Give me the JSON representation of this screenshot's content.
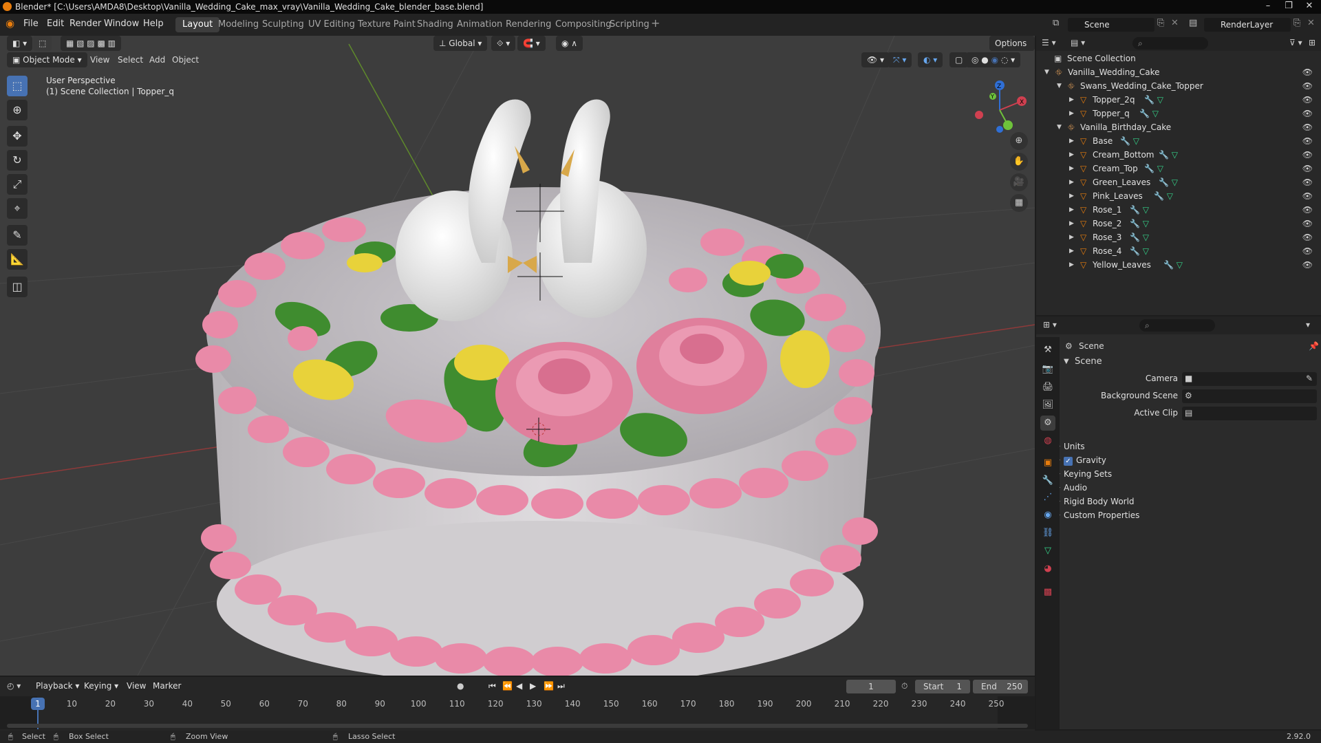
{
  "title": "Blender* [C:\\Users\\AMDA8\\Desktop\\Vanilla_Wedding_Cake_max_vray\\Vanilla_Wedding_Cake_blender_base.blend]",
  "menu": [
    "File",
    "Edit",
    "Render",
    "Window",
    "Help"
  ],
  "workspaces": [
    "Layout",
    "Modeling",
    "Sculpting",
    "UV Editing",
    "Texture Paint",
    "Shading",
    "Animation",
    "Rendering",
    "Compositing",
    "Scripting"
  ],
  "active_workspace": "Layout",
  "scene_name": "Scene",
  "view_layer": "RenderLayer",
  "viewport": {
    "transform_orientation": "Global",
    "options_label": "Options",
    "mode": "Object Mode",
    "header_menus": [
      "View",
      "Select",
      "Add",
      "Object"
    ],
    "info_line1": "User Perspective",
    "info_line2": "(1) Scene Collection | Topper_q"
  },
  "outliner": {
    "root": "Scene Collection",
    "rows": [
      {
        "label": "Vanilla_Wedding_Cake",
        "level": 1,
        "type": "collection"
      },
      {
        "label": "Swans_Wedding_Cake_Topper",
        "level": 2,
        "type": "collection"
      },
      {
        "label": "Topper_2q",
        "level": 3,
        "type": "mesh"
      },
      {
        "label": "Topper_q",
        "level": 3,
        "type": "mesh"
      },
      {
        "label": "Vanilla_Birthday_Cake",
        "level": 2,
        "type": "collection"
      },
      {
        "label": "Base",
        "level": 3,
        "type": "mesh"
      },
      {
        "label": "Cream_Bottom",
        "level": 3,
        "type": "mesh"
      },
      {
        "label": "Cream_Top",
        "level": 3,
        "type": "mesh"
      },
      {
        "label": "Green_Leaves",
        "level": 3,
        "type": "mesh"
      },
      {
        "label": "Pink_Leaves",
        "level": 3,
        "type": "mesh"
      },
      {
        "label": "Rose_1",
        "level": 3,
        "type": "mesh"
      },
      {
        "label": "Rose_2",
        "level": 3,
        "type": "mesh"
      },
      {
        "label": "Rose_3",
        "level": 3,
        "type": "mesh"
      },
      {
        "label": "Rose_4",
        "level": 3,
        "type": "mesh"
      },
      {
        "label": "Yellow_Leaves",
        "level": 3,
        "type": "mesh"
      }
    ]
  },
  "properties": {
    "context": "Scene",
    "panel_title": "Scene",
    "camera_label": "Camera",
    "background_scene_label": "Background Scene",
    "active_clip_label": "Active Clip",
    "sections": [
      "Units",
      "Gravity",
      "Keying Sets",
      "Audio",
      "Rigid Body World",
      "Custom Properties"
    ],
    "gravity_checked": true
  },
  "timeline": {
    "menus": [
      "Playback",
      "Keying",
      "View",
      "Marker"
    ],
    "current_frame": "1",
    "start_label": "Start",
    "start": "1",
    "end_label": "End",
    "end": "250",
    "ruler": [
      "1",
      "10",
      "20",
      "30",
      "40",
      "50",
      "60",
      "70",
      "80",
      "90",
      "100",
      "110",
      "120",
      "130",
      "140",
      "150",
      "160",
      "170",
      "180",
      "190",
      "200",
      "210",
      "220",
      "230",
      "240",
      "250"
    ]
  },
  "statusbar": {
    "select": "Select",
    "box_select": "Box Select",
    "zoom_view": "Zoom View",
    "lasso_select": "Lasso Select",
    "version": "2.92.0"
  },
  "colors": {
    "accent": "#4772b3",
    "cake_pink": "#e98aa8",
    "cake_white": "#d8d5d8",
    "leaf_green": "#3f8c2f",
    "yellow_leaf": "#e8d23a"
  }
}
